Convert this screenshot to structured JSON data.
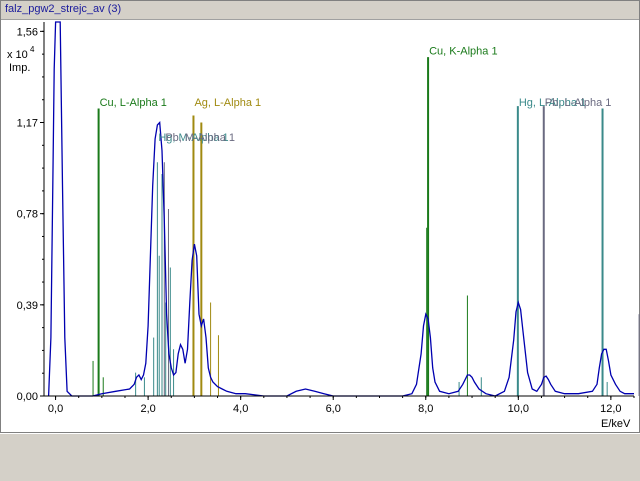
{
  "window": {
    "title": "falz_pgw2_strejc_av (3)"
  },
  "chart_data": {
    "type": "line",
    "title": "",
    "ylabel_exponent": "x 10",
    "ylabel_power": "4",
    "ylabel_unit": "Imp.",
    "xlabel": "E/keV",
    "xlim": [
      -0.25,
      12.5
    ],
    "ylim": [
      0,
      1.6
    ],
    "x_ticks": [
      {
        "v": 0.0,
        "label": "0,0"
      },
      {
        "v": 2.0,
        "label": "2,0"
      },
      {
        "v": 4.0,
        "label": "4,0"
      },
      {
        "v": 6.0,
        "label": "6,0"
      },
      {
        "v": 8.0,
        "label": "8,0"
      },
      {
        "v": 10.0,
        "label": "10,0"
      },
      {
        "v": 12.0,
        "label": "12,0"
      }
    ],
    "y_ticks": [
      {
        "v": 0.0,
        "label": "0,00"
      },
      {
        "v": 0.39,
        "label": "0,39"
      },
      {
        "v": 0.78,
        "label": "0,78"
      },
      {
        "v": 1.17,
        "label": "1,17"
      },
      {
        "v": 1.56,
        "label": "1,56"
      }
    ],
    "spectrum": {
      "name": "spectrum",
      "color": "#0000b0",
      "x": [
        -0.15,
        -0.1,
        -0.06,
        -0.03,
        0.0,
        0.05,
        0.1,
        0.15,
        0.2,
        0.25,
        0.35,
        0.5,
        0.8,
        1.0,
        1.3,
        1.6,
        1.7,
        1.75,
        1.8,
        1.85,
        1.9,
        1.95,
        2.0,
        2.05,
        2.1,
        2.15,
        2.2,
        2.25,
        2.3,
        2.35,
        2.4,
        2.45,
        2.5,
        2.55,
        2.6,
        2.65,
        2.7,
        2.75,
        2.8,
        2.85,
        2.9,
        2.95,
        3.0,
        3.05,
        3.1,
        3.15,
        3.2,
        3.25,
        3.3,
        3.35,
        3.4,
        3.5,
        3.6,
        3.7,
        3.8,
        3.9,
        4.1,
        4.5,
        5.0,
        5.2,
        5.4,
        5.6,
        5.8,
        6.0,
        6.3,
        6.5,
        7.0,
        7.5,
        7.7,
        7.8,
        7.9,
        7.95,
        8.0,
        8.05,
        8.1,
        8.15,
        8.2,
        8.3,
        8.5,
        8.7,
        8.8,
        8.9,
        8.95,
        9.0,
        9.05,
        9.15,
        9.3,
        9.5,
        9.7,
        9.8,
        9.9,
        9.95,
        10.0,
        10.05,
        10.1,
        10.2,
        10.3,
        10.4,
        10.5,
        10.55,
        10.6,
        10.65,
        10.7,
        10.8,
        11.0,
        11.3,
        11.6,
        11.7,
        11.75,
        11.8,
        11.85,
        11.9,
        11.95,
        12.0,
        12.1,
        12.2,
        12.3,
        12.5
      ],
      "y": [
        0.0,
        0.25,
        0.9,
        1.4,
        1.7,
        1.7,
        1.7,
        0.9,
        0.25,
        0.02,
        0.0,
        0.0,
        0.0,
        0.01,
        0.02,
        0.03,
        0.05,
        0.08,
        0.09,
        0.07,
        0.09,
        0.14,
        0.3,
        0.6,
        0.9,
        1.1,
        1.16,
        1.17,
        1.05,
        0.75,
        0.35,
        0.18,
        0.12,
        0.09,
        0.1,
        0.18,
        0.22,
        0.2,
        0.14,
        0.2,
        0.4,
        0.58,
        0.65,
        0.6,
        0.35,
        0.3,
        0.33,
        0.25,
        0.12,
        0.08,
        0.06,
        0.04,
        0.03,
        0.02,
        0.015,
        0.01,
        0.01,
        0.0,
        0.0,
        0.02,
        0.03,
        0.02,
        0.01,
        0.0,
        0.0,
        0.0,
        0.0,
        0.0,
        0.01,
        0.05,
        0.18,
        0.3,
        0.35,
        0.33,
        0.25,
        0.12,
        0.06,
        0.02,
        0.01,
        0.02,
        0.05,
        0.09,
        0.09,
        0.08,
        0.06,
        0.03,
        0.01,
        0.0,
        0.02,
        0.08,
        0.24,
        0.36,
        0.4,
        0.37,
        0.28,
        0.1,
        0.03,
        0.02,
        0.05,
        0.08,
        0.085,
        0.07,
        0.05,
        0.02,
        0.01,
        0.01,
        0.02,
        0.05,
        0.12,
        0.18,
        0.2,
        0.2,
        0.15,
        0.09,
        0.05,
        0.02,
        0.01,
        0.01
      ]
    },
    "markers": [
      {
        "name": "Cu, L-Alpha 1",
        "color": "#1a7a1a",
        "group": "cu",
        "lines": [
          [
            0.93,
            1.23
          ],
          [
            0.81,
            0.15
          ],
          [
            1.03,
            0.08
          ]
        ],
        "label_at": 0.93
      },
      {
        "name": "Ag, L-Alpha 1",
        "color": "#a08a10",
        "group": "ag",
        "lines": [
          [
            2.98,
            1.2
          ],
          [
            3.15,
            1.17
          ],
          [
            3.35,
            0.4
          ],
          [
            3.52,
            0.26
          ]
        ],
        "label_at": 2.98
      },
      {
        "name": "Cu, K-Alpha 1",
        "color": "#1a7a1a",
        "group": "cu",
        "lines": [
          [
            8.05,
            1.45
          ],
          [
            8.02,
            0.72
          ],
          [
            8.9,
            0.43
          ]
        ],
        "label_at": 8.05
      },
      {
        "name": "Hg, M-Alpha 1",
        "color": "#3a8a8a",
        "group": "hg",
        "lines": [
          [
            2.2,
            1.0
          ],
          [
            2.3,
            0.95
          ],
          [
            2.48,
            0.55
          ],
          [
            1.73,
            0.1
          ],
          [
            1.92,
            0.08
          ],
          [
            2.12,
            0.25
          ],
          [
            2.24,
            0.6
          ],
          [
            2.38,
            0.4
          ],
          [
            2.55,
            0.2
          ]
        ],
        "label_at": 2.2
      },
      {
        "name": "Hg, L-Alpha 1",
        "color": "#3a8a8a",
        "group": "hg",
        "lines": [
          [
            9.99,
            1.24
          ],
          [
            11.82,
            1.23
          ],
          [
            8.72,
            0.06
          ],
          [
            9.2,
            0.08
          ],
          [
            11.92,
            0.06
          ]
        ],
        "label_at": 9.99
      },
      {
        "name": "Pb, L-Alpha 1",
        "color": "#6a6a80",
        "group": "pb",
        "lines": [
          [
            10.55,
            1.24
          ],
          [
            12.61,
            0.35
          ]
        ],
        "label_at": 10.55
      },
      {
        "name": "Pb, M-Alpha 1",
        "color": "#6a6a80",
        "group": "pb",
        "lines": [
          [
            2.35,
            1.0
          ],
          [
            2.44,
            0.8
          ]
        ],
        "label_at": 2.35
      }
    ],
    "overlap_labels": [
      {
        "text": "Hg, M-Alpha 1",
        "color": "#3a8a8a",
        "at_x": 2.2,
        "at_y": 1.09
      },
      {
        "text": "Pb, M-Alpha 1",
        "color": "#6a6a80",
        "at_x": 2.35,
        "at_y": 1.09
      },
      {
        "text": "Ag, L-Alpha 1",
        "color": "#a08a10",
        "at_x": 2.98,
        "at_y": 1.24
      },
      {
        "text": "Cu, L-Alpha 1",
        "color": "#1a7a1a",
        "at_x": 0.93,
        "at_y": 1.24
      },
      {
        "text": "Cu, K-Alpha 1",
        "color": "#1a7a1a",
        "at_x": 8.05,
        "at_y": 1.46
      },
      {
        "text": "Hg, L-Alpha 1",
        "color": "#3a8a8a",
        "at_x": 9.99,
        "at_y": 1.24
      },
      {
        "text": "Pb, L-Alpha 1",
        "color": "#6a6a80",
        "at_x": 10.55,
        "at_y": 1.24
      }
    ],
    "grid": false,
    "legend": "none"
  }
}
